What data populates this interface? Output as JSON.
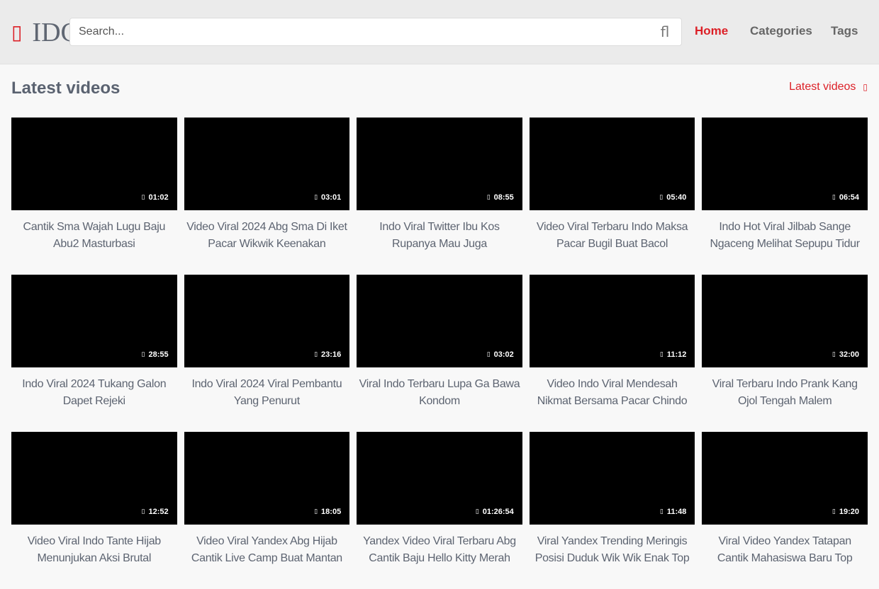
{
  "header": {
    "logo_icon": "▯",
    "logo_text": "IDC",
    "search_placeholder": "Search...",
    "search_icon": "ﬂ",
    "nav": [
      {
        "label": "Home",
        "active": true
      },
      {
        "label": "Categories",
        "active": false
      },
      {
        "label": "Tags",
        "active": false
      }
    ]
  },
  "main": {
    "section_title": "Latest videos",
    "section_link": "Latest videos",
    "section_link_icon": "▯",
    "clock_icon": "▯",
    "videos": [
      {
        "title": "Cantik Sma Wajah Lugu Baju Abu2 Masturbasi",
        "duration": "01:02"
      },
      {
        "title": "Video Viral 2024 Abg Sma Di Iket Pacar Wikwik Keenakan",
        "duration": "03:01"
      },
      {
        "title": "Indo Viral Twitter Ibu Kos Rupanya Mau Juga",
        "duration": "08:55"
      },
      {
        "title": "Video Viral Terbaru Indo Maksa Pacar Bugil Buat Bacol",
        "duration": "05:40"
      },
      {
        "title": "Indo Hot Viral Jilbab Sange Ngaceng Melihat Sepupu Tidur",
        "duration": "06:54"
      },
      {
        "title": "Indo Viral 2024 Tukang Galon Dapet Rejeki",
        "duration": "28:55"
      },
      {
        "title": "Indo Viral 2024 Viral Pembantu Yang Penurut",
        "duration": "23:16"
      },
      {
        "title": "Viral Indo Terbaru Lupa Ga Bawa Kondom",
        "duration": "03:02"
      },
      {
        "title": "Video Indo Viral Mendesah Nikmat Bersama Pacar Chindo",
        "duration": "11:12"
      },
      {
        "title": "Viral Terbaru Indo Prank Kang Ojol Tengah Malem",
        "duration": "32:00"
      },
      {
        "title": "Video Viral Indo Tante Hijab Menunjukan Aksi Brutal",
        "duration": "12:52"
      },
      {
        "title": "Video Viral Yandex Abg Hijab Cantik Live Camp Buat Mantan",
        "duration": "18:05"
      },
      {
        "title": "Yandex Video Viral Terbaru Abg Cantik Baju Hello Kitty Merah",
        "duration": "01:26:54"
      },
      {
        "title": "Viral Yandex Trending Meringis Posisi Duduk Wik Wik Enak Top",
        "duration": "11:48"
      },
      {
        "title": "Viral Video Yandex Tatapan Cantik Mahasiswa Baru Top Trending",
        "duration": "19:20"
      }
    ]
  },
  "colors": {
    "accent": "#dc1f26",
    "text": "#5d6471",
    "background": "#f8f8f8",
    "header_bg": "#ebebeb"
  }
}
